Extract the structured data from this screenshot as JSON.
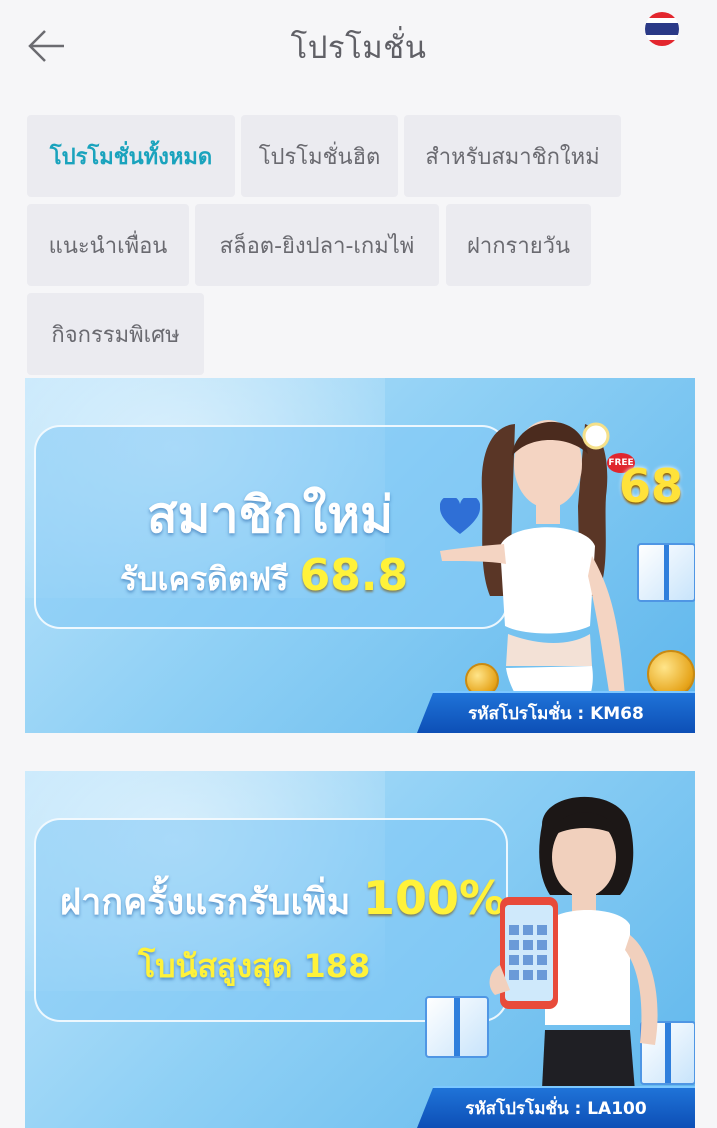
{
  "header": {
    "title": "โปรโมชั่น",
    "back_icon": "arrow-left-icon",
    "flag_icon": "thailand-flag-icon"
  },
  "categories": [
    {
      "label": "โปรโมชั่นทั้งหมด",
      "active": true
    },
    {
      "label": "โปรโมชั่นฮิต",
      "active": false
    },
    {
      "label": "สำหรับสมาชิกใหม่",
      "active": false
    },
    {
      "label": "แนะนำเพื่อน",
      "active": false
    },
    {
      "label": "สล็อต-ยิงปลา-เกมไพ่",
      "active": false
    },
    {
      "label": "ฝากรายวัน",
      "active": false
    },
    {
      "label": "กิจกรรมพิเศษ",
      "active": false
    }
  ],
  "colors": {
    "accent": "#1aa3bd",
    "chip_bg": "#ebebf0",
    "page_bg": "#f6f6f8",
    "banner_code_bg": "#1565d0",
    "highlight_yellow": "#fff23a"
  },
  "promos": [
    {
      "headline": "สมาชิกใหม่",
      "subline_prefix": "รับเครดิตฟรี",
      "subline_amount": "68.8",
      "badge_small": "FREE",
      "badge_amount": "68",
      "code": "รหัสโปรโมชั่น : KM68"
    },
    {
      "headline_prefix": "ฝากครั้งแรกรับเพิ่ม",
      "headline_amount": "100%",
      "subline": "โบนัสสูงสุด 188",
      "code": "รหัสโปรโมชั่น : LA100"
    }
  ]
}
